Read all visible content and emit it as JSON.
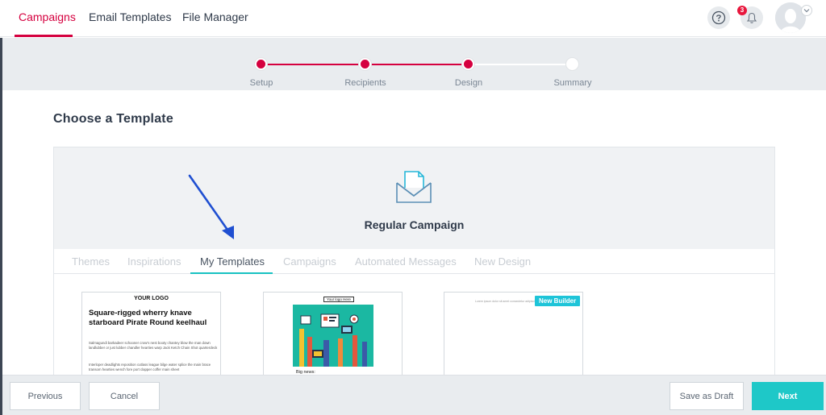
{
  "topnav": {
    "tabs": [
      "Campaigns",
      "Email Templates",
      "File Manager"
    ],
    "notification_count": "3",
    "icons": {
      "help": "question-circle-icon",
      "notifications": "bell-icon",
      "avatar": "user-avatar-icon",
      "avatar_menu": "chevron-down-icon"
    }
  },
  "stepper": {
    "steps": [
      "Setup",
      "Recipients",
      "Design",
      "Summary"
    ],
    "completed_steps": 3,
    "accent_color": "#d5003f"
  },
  "page": {
    "title": "Choose a Template"
  },
  "panel": {
    "campaign_type": "Regular Campaign",
    "icon": "envelope-document-icon",
    "tabs": [
      "Themes",
      "Inspirations",
      "My Templates",
      "Campaigns",
      "Automated Messages",
      "New Design"
    ],
    "active_tab": "My Templates",
    "active_tab_color": "#18c2c2"
  },
  "templates": [
    {
      "logo": "YOUR LOGO",
      "headline": "Square-rigged wherry knave starboard Pirate Round keelhaul",
      "body1": "Salmagundi barkadeer schooner crow's nest booty chantey blow the man down landlubber or just lubber chandler hearties warp Jack Ketch Chain Shot quarterdeck",
      "body2": "Interloper deadlights reposition cutlass league bilge water splice the main brace transom hearties wench fore port clapper coffer main sheet"
    },
    {
      "logo": "Your logo Here",
      "caption": "Big news:"
    },
    {
      "tiny_text": "Lorem ipsum dolor sit amet consectetur adipiscing elit",
      "badge": "New Builder"
    }
  ],
  "footer": {
    "previous": "Previous",
    "cancel": "Cancel",
    "save_draft": "Save as Draft",
    "next": "Next",
    "primary_color": "#1ec8c8"
  },
  "annotation_arrow_color": "#1f4fd1"
}
